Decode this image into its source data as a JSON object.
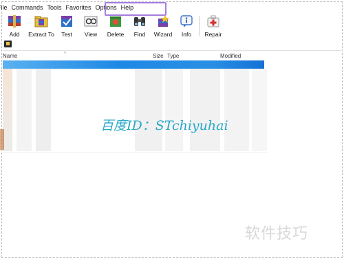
{
  "menubar": {
    "items": [
      "File",
      "Commands",
      "Tools",
      "Favorites",
      "Options",
      "Help"
    ]
  },
  "toolbar": {
    "buttons": [
      {
        "label": "Add",
        "icon": "add-archive-icon"
      },
      {
        "label": "Extract To",
        "icon": "extract-to-icon"
      },
      {
        "label": "Test",
        "icon": "test-icon"
      },
      {
        "label": "View",
        "icon": "view-icon"
      },
      {
        "label": "Delete",
        "icon": "delete-icon"
      },
      {
        "label": "Find",
        "icon": "find-icon"
      },
      {
        "label": "Wizard",
        "icon": "wizard-icon"
      },
      {
        "label": "Info",
        "icon": "info-icon"
      },
      {
        "label": "Repair",
        "icon": "repair-icon"
      }
    ]
  },
  "filelist": {
    "columns": [
      "Name",
      "Size",
      "Type",
      "Modified"
    ]
  },
  "watermark": {
    "center": "百度ID：STchiyuhai",
    "corner": "软件技巧"
  },
  "colors": {
    "highlight_box": "#a57be0",
    "selection": "#1e88e5",
    "watermark": "#29a8c8"
  }
}
